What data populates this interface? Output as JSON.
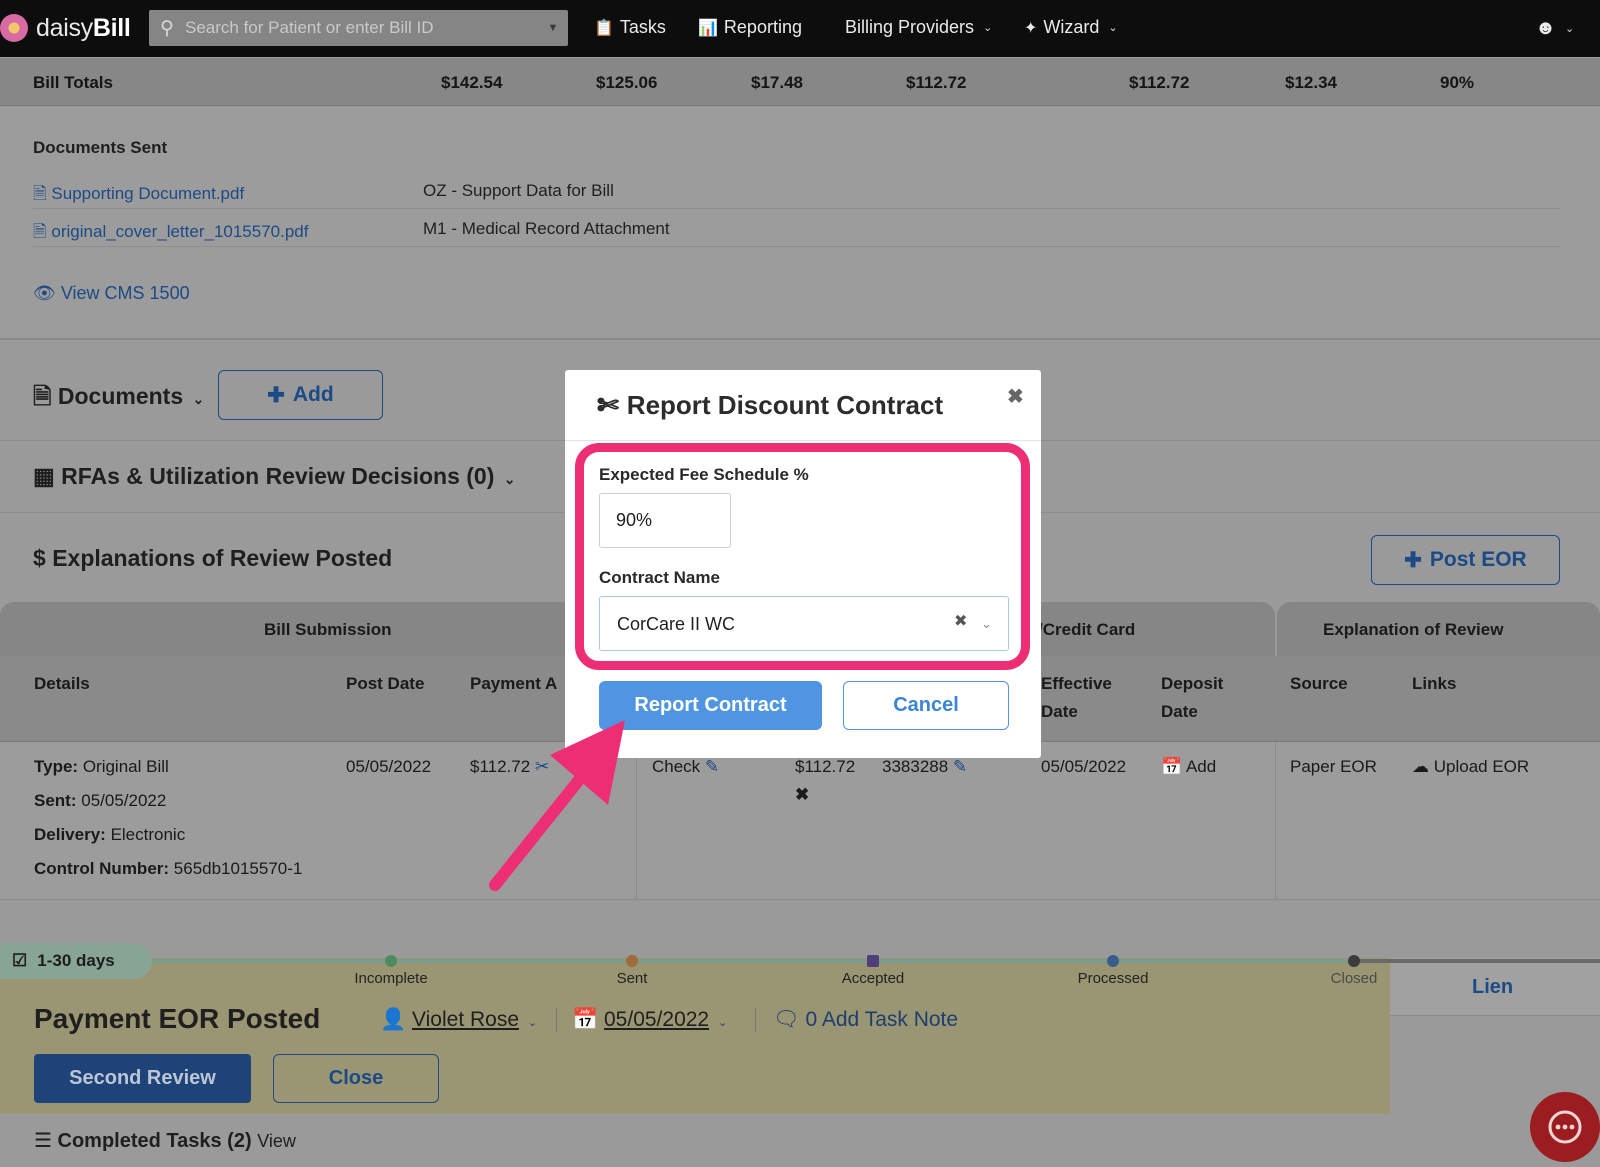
{
  "nav": {
    "brand_a": "daisy",
    "brand_b": "Bill",
    "search_placeholder": "Search for Patient or enter Bill ID",
    "tasks": "Tasks",
    "reporting": "Reporting",
    "billing_providers": "Billing Providers",
    "wizard": "Wizard"
  },
  "totals": {
    "label": "Bill Totals",
    "values": [
      "$142.54",
      "$125.06",
      "$17.48",
      "$112.72",
      "$112.72",
      "$12.34",
      "90%"
    ]
  },
  "documents_sent": {
    "heading": "Documents Sent",
    "rows": [
      {
        "file": "Supporting Document.pdf",
        "desc": "OZ - Support Data for Bill"
      },
      {
        "file": "original_cover_letter_1015570.pdf",
        "desc": "M1 - Medical Record Attachment"
      }
    ],
    "view_link": "View CMS 1500"
  },
  "documents": {
    "title": "Documents",
    "add": "Add"
  },
  "rfas": {
    "title": "RFAs & Utilization Review Decisions (0)"
  },
  "eor": {
    "title": "Explanations of Review Posted",
    "post_button": "Post EOR",
    "group_headers": {
      "bill_submission": "Bill Submission",
      "credit_card": "/Credit Card",
      "explanation": "Explanation of Review"
    },
    "columns": {
      "details": "Details",
      "post_date": "Post Date",
      "payment": "Payment A",
      "effective": "Effective Date",
      "deposit": "Deposit Date",
      "source": "Source",
      "links": "Links"
    },
    "row": {
      "type_label": "Type:",
      "type_value": "Original Bill",
      "sent_label": "Sent:",
      "sent_value": "05/05/2022",
      "delivery_label": "Delivery:",
      "delivery_value": "Electronic",
      "control_label": "Control Number:",
      "control_value": "565db1015570-1",
      "post_date": "05/05/2022",
      "payment": "$112.72",
      "method": "Check",
      "amount": "$112.72",
      "check_no": "3383288",
      "effective_date": "05/05/2022",
      "deposit_add": "Add",
      "source": "Paper EOR",
      "upload": "Upload EOR"
    }
  },
  "task": {
    "days": "1-30 days",
    "stages": [
      "Incomplete",
      "Sent",
      "Accepted",
      "Processed",
      "Closed"
    ],
    "lien": "Lien",
    "status": "Payment EOR Posted",
    "assignee": "Violet Rose",
    "date": "05/05/2022",
    "note": "0 Add Task Note",
    "second_review": "Second Review",
    "close": "Close",
    "completed": "Completed Tasks (2)",
    "view": "View"
  },
  "modal": {
    "title": "Report Discount Contract",
    "fee_label": "Expected Fee Schedule %",
    "fee_value": "90%",
    "contract_label": "Contract Name",
    "contract_value": "CorCare II WC",
    "report_button": "Report Contract",
    "cancel_button": "Cancel"
  },
  "colors": {
    "highlight": "#ee2e74",
    "primary_button": "#4f95e2",
    "nav_bg": "#0d0d0d"
  }
}
